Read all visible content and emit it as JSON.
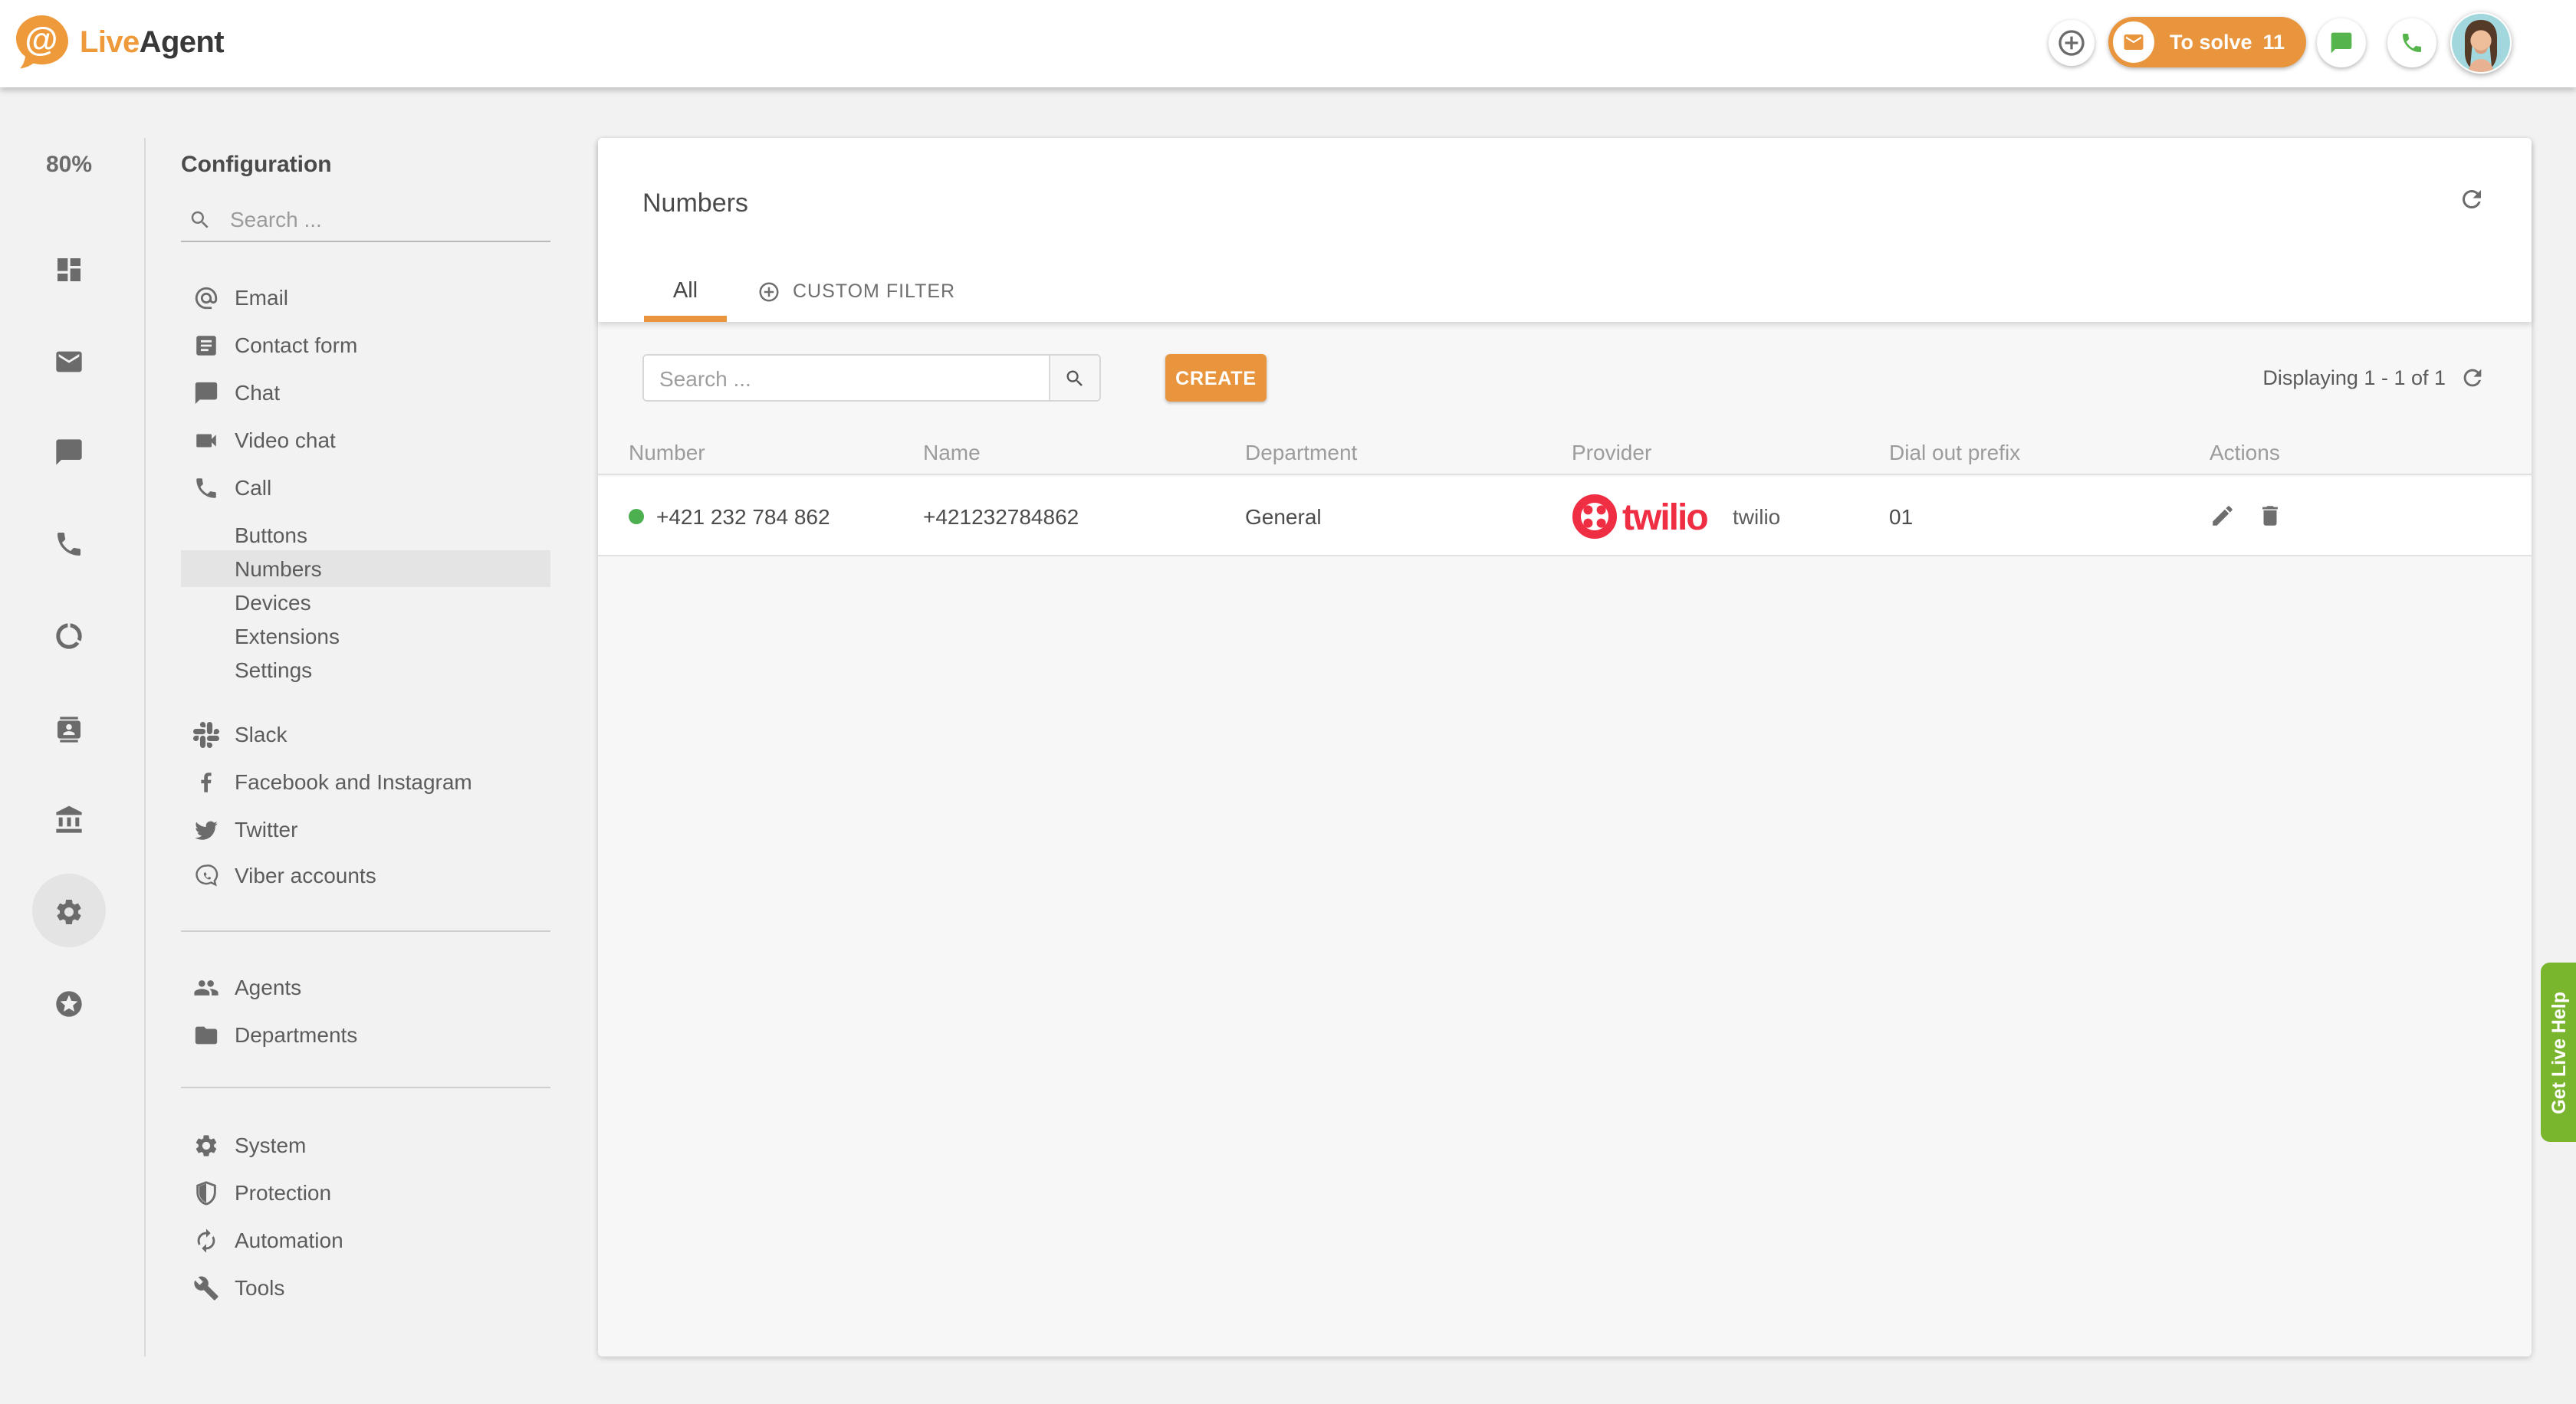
{
  "header": {
    "brand": {
      "live": "Live",
      "agent": "Agent"
    },
    "to_solve": {
      "label": "To solve",
      "count": "11"
    }
  },
  "icon_rail": {
    "usage": "80%"
  },
  "sidebar": {
    "title": "Configuration",
    "search_placeholder": "Search ...",
    "items": [
      {
        "label": "Email"
      },
      {
        "label": "Contact form"
      },
      {
        "label": "Chat"
      },
      {
        "label": "Video chat"
      },
      {
        "label": "Call"
      },
      {
        "label": "Buttons"
      },
      {
        "label": "Numbers",
        "active": true
      },
      {
        "label": "Devices"
      },
      {
        "label": "Extensions"
      },
      {
        "label": "Settings"
      },
      {
        "label": "Slack"
      },
      {
        "label": "Facebook and Instagram"
      },
      {
        "label": "Twitter"
      },
      {
        "label": "Viber accounts"
      },
      {
        "label": "Agents"
      },
      {
        "label": "Departments"
      },
      {
        "label": "System"
      },
      {
        "label": "Protection"
      },
      {
        "label": "Automation"
      },
      {
        "label": "Tools"
      }
    ]
  },
  "main": {
    "title": "Numbers",
    "tabs": [
      {
        "label": "All",
        "active": true
      },
      {
        "label": "CUSTOM FILTER"
      }
    ],
    "toolbar": {
      "search_placeholder": "Search ...",
      "create_label": "CREATE",
      "displaying": "Displaying 1 - 1 of 1"
    },
    "table": {
      "columns": [
        "Number",
        "Name",
        "Department",
        "Provider",
        "Dial out prefix",
        "Actions"
      ],
      "rows": [
        {
          "status": "online",
          "number": "+421 232 784 862",
          "name": "+421232784862",
          "department": "General",
          "provider_logo_text": "twilio",
          "provider": "twilio",
          "dial_out_prefix": "01"
        }
      ]
    }
  },
  "help_tab": {
    "label": "Get Live Help"
  },
  "colors": {
    "brand_orange": "#e8953d",
    "icon_green": "#56b44c",
    "status_green": "#4caf50",
    "help_green": "#79b62e",
    "twilio_red": "#ef2e43",
    "page_bg": "#f2f2f2"
  }
}
